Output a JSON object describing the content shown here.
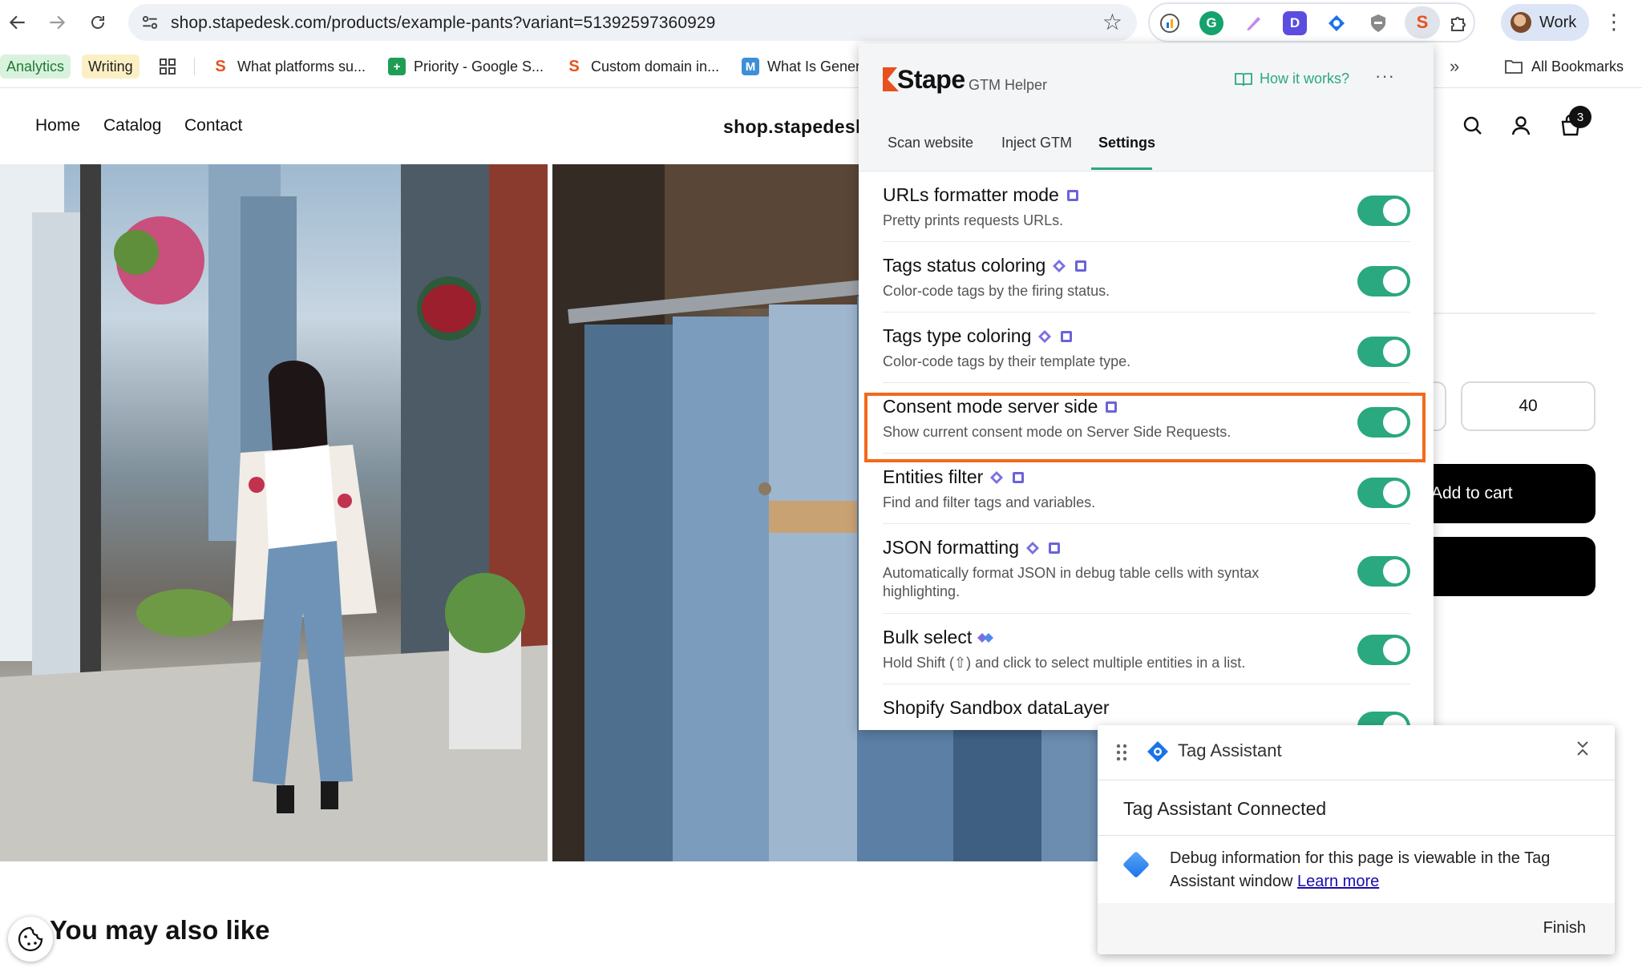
{
  "browser": {
    "url": "shop.stapedesk.com/products/example-pants?variant=51392597360929",
    "profile_label": "Work",
    "extensions": [
      "google-analytics-debugger-icon",
      "grammarly-icon",
      "pen-icon",
      "d-extension-icon",
      "tag-assistant-extension-icon",
      "shield-extension-icon",
      "stape-extension-icon",
      "puzzle-extensions-icon"
    ]
  },
  "bookmarks": {
    "items": [
      {
        "label": "Analytics",
        "chip": true,
        "color": "#d9f2dd"
      },
      {
        "label": "Writing",
        "chip": true,
        "color": "#fbf0c4"
      },
      {
        "label": "What platforms su...",
        "icon": "stape-icon"
      },
      {
        "label": "Priority - Google S...",
        "icon": "sheets-icon"
      },
      {
        "label": "Custom domain in...",
        "icon": "stape-icon"
      },
      {
        "label": "What Is Gener",
        "icon": "mail-icon"
      }
    ],
    "all_bookmarks": "All Bookmarks"
  },
  "shop": {
    "nav": [
      "Home",
      "Catalog",
      "Contact"
    ],
    "title": "shop.stapedesk",
    "cart_count": "3",
    "variant_size": "40",
    "add_to_cart": "Add to cart",
    "also_like": "You may also like"
  },
  "stape": {
    "brand": "Stape",
    "subtitle": "GTM Helper",
    "how_it_works": "How it works?",
    "more": "···",
    "tabs": [
      "Scan website",
      "Inject GTM",
      "Settings"
    ],
    "active_tab": "Settings",
    "accent": "#2aa87f",
    "highlight_color": "#f26a1b",
    "settings": [
      {
        "title": "URLs formatter mode",
        "desc": "Pretty prints requests URLs.",
        "badges": [
          "gtm-badge-icon"
        ],
        "enabled": true
      },
      {
        "title": "Tags status coloring",
        "desc": "Color-code tags by the firing status.",
        "badges": [
          "ga-badge-icon",
          "gtm-badge-icon"
        ],
        "enabled": true
      },
      {
        "title": "Tags type coloring",
        "desc": "Color-code tags by their template type.",
        "badges": [
          "ga-badge-icon",
          "gtm-badge-icon"
        ],
        "enabled": true
      },
      {
        "title": "Consent mode server side",
        "desc": "Show current consent mode on Server Side Requests.",
        "badges": [
          "gtm-badge-icon"
        ],
        "enabled": true
      },
      {
        "title": "Entities filter",
        "desc": "Find and filter tags and variables.",
        "badges": [
          "ga-badge-icon",
          "gtm-badge-icon"
        ],
        "enabled": true
      },
      {
        "title": "JSON formatting",
        "desc": "Automatically format JSON in debug table cells with syntax highlighting.",
        "badges": [
          "ga-badge-icon",
          "gtm-badge-icon"
        ],
        "enabled": true
      },
      {
        "title": "Bulk select",
        "desc": "Hold Shift (⇧) and click to select multiple entities in a list.",
        "badges": [
          "diamond-badge-icon"
        ],
        "enabled": true
      },
      {
        "title": "Shopify Sandbox dataLayer",
        "desc": "",
        "badges": [],
        "enabled": true
      }
    ]
  },
  "tag_assistant": {
    "title": "Tag Assistant",
    "connected": "Tag Assistant Connected",
    "info": "Debug information for this page is viewable in the Tag Assistant window",
    "learn_more": "Learn more",
    "finish": "Finish"
  }
}
